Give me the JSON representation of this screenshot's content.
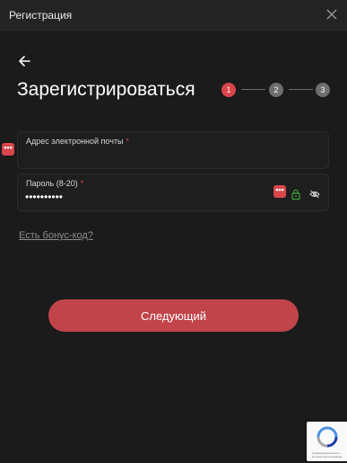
{
  "window": {
    "title": "Регистрация"
  },
  "page": {
    "heading": "Зарегистрироваться"
  },
  "steps": [
    "1",
    "2",
    "3"
  ],
  "email": {
    "label": "Адрес электронной почты",
    "required_mark": "*",
    "value": ""
  },
  "password": {
    "label": "Пароль (8-20)",
    "required_mark": "*",
    "value": "••••••••••"
  },
  "autofill_badge": "•••",
  "bonus_link": "Есть бонус-код?",
  "next_button": "Следующий",
  "recaptcha": {
    "text": "Конфиденциальность - Условия использования"
  },
  "colors": {
    "accent": "#d9454b",
    "button": "#c1444a",
    "background": "#1b1b1b",
    "step_inactive": "#6e6e6e",
    "lock": "#3ba33a"
  },
  "icons": {
    "close": "close-icon",
    "back": "arrow-left-icon",
    "lock": "lock-icon",
    "eye": "eye-off-icon",
    "recaptcha": "recaptcha-icon"
  }
}
